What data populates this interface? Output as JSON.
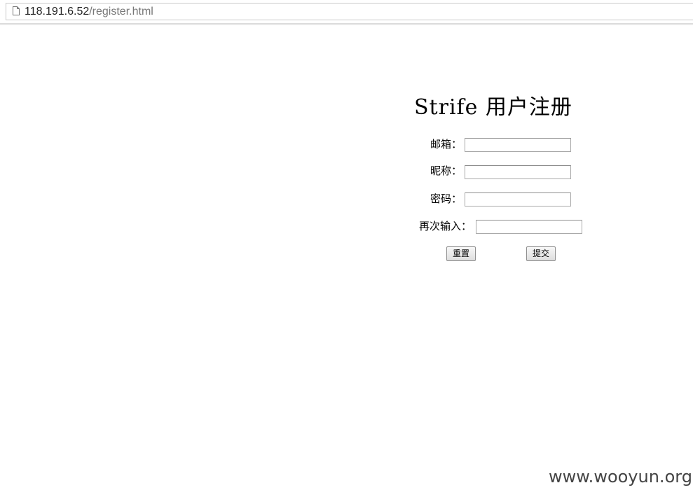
{
  "browser": {
    "url_host": "118.191.6.52",
    "url_path": "/register.html",
    "icon": "page-icon"
  },
  "form": {
    "title": "Strife 用户注册",
    "email_label": "邮箱：",
    "email_value": "",
    "nickname_label": "昵称：",
    "nickname_value": "",
    "password_label": "密码：",
    "password_value": "",
    "confirm_label": "再次输入：",
    "confirm_value": "",
    "reset_label": "重置",
    "submit_label": "提交"
  },
  "watermark": "www.wooyun.org"
}
